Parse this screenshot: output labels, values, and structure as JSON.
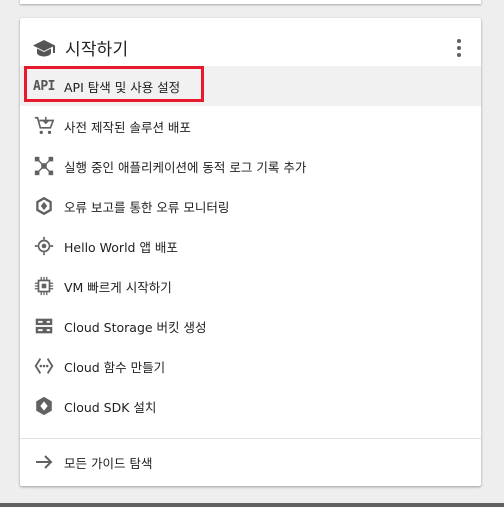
{
  "card": {
    "title": "시작하기",
    "header_icon": "school-icon",
    "more_icon": "more-vert-icon"
  },
  "items": [
    {
      "label": "API 탐색 및 사용 설정",
      "icon": "api-icon",
      "icon_text": "API",
      "highlighted": true
    },
    {
      "label": "사전 제작된 솔루션 배포",
      "icon": "cart-icon"
    },
    {
      "label": "실행 중인 애플리케이션에 동적 로그 기록 추가",
      "icon": "scatter-icon"
    },
    {
      "label": "오류 보고를 통한 오류 모니터링",
      "icon": "error-reporting-icon"
    },
    {
      "label": "Hello World 앱 배포",
      "icon": "app-engine-icon"
    },
    {
      "label": "VM 빠르게 시작하기",
      "icon": "chip-icon"
    },
    {
      "label": "Cloud Storage 버킷 생성",
      "icon": "storage-icon"
    },
    {
      "label": "Cloud 함수 만들기",
      "icon": "functions-icon"
    },
    {
      "label": "Cloud SDK 설치",
      "icon": "sdk-icon"
    }
  ],
  "footer": {
    "label": "모든 가이드 탐색",
    "icon": "arrow-right-icon"
  },
  "colors": {
    "highlight": "#e8192c",
    "icon": "#616161",
    "active_row": "#f1f1f1"
  }
}
